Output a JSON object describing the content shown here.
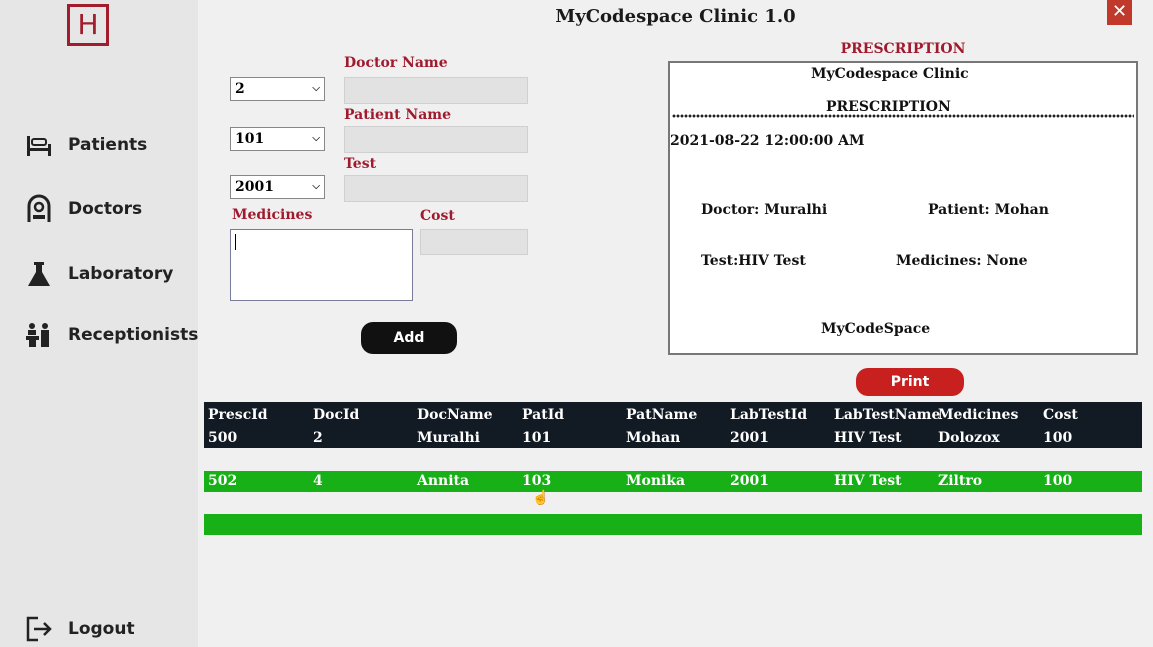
{
  "window": {
    "title": "MyCodespace Clinic 1.0",
    "close_label": "✕"
  },
  "sidebar": {
    "logo_letter": "H",
    "items": [
      {
        "label": "Patients",
        "icon": "bed-icon"
      },
      {
        "label": "Doctors",
        "icon": "doctor-icon"
      },
      {
        "label": "Laboratory",
        "icon": "flask-icon"
      },
      {
        "label": "Receptionists",
        "icon": "people-icon"
      }
    ],
    "logout": {
      "label": "Logout",
      "icon": "logout-icon"
    }
  },
  "form": {
    "doctor_id": "2",
    "patient_id": "101",
    "test_id": "2001",
    "doctor_name_label": "Doctor Name",
    "patient_name_label": "Patient Name",
    "test_label": "Test",
    "medicines_label": "Medicines",
    "cost_label": "Cost",
    "doctor_name_value": "",
    "patient_name_value": "",
    "test_value": "",
    "medicines_value": "",
    "cost_value": "",
    "add_label": "Add"
  },
  "prescription": {
    "heading": "PRESCRIPTION",
    "clinic": "MyCodespace Clinic",
    "title": "PRESCRIPTION",
    "date": "2021-08-22 12:00:00 AM",
    "doctor": "Doctor: Muralhi",
    "patient": "Patient: Mohan",
    "test": "Test:HIV Test",
    "medicines": "Medicines: None",
    "footer": "MyCodeSpace",
    "print_label": "Print"
  },
  "table": {
    "headers": [
      "PrescId",
      "DocId",
      "DocName",
      "PatId",
      "PatName",
      "LabTestId",
      "LabTestName",
      "Medicines",
      "Cost"
    ],
    "rows": [
      [
        "500",
        "2",
        "Muralhi",
        "101",
        "Mohan",
        "2001",
        "HIV Test",
        "Dolozox",
        "100"
      ],
      [
        "502",
        "4",
        "Annita",
        "103",
        "Monika",
        "2001",
        "HIV Test",
        "Ziltro",
        "100"
      ],
      [
        "",
        "",
        "",
        "",
        "",
        "",
        "",
        "",
        ""
      ]
    ],
    "colors": {
      "header": "#121a24",
      "selected": "#17b117"
    }
  },
  "colors": {
    "accent": "#a01a2e",
    "print": "#c8201e",
    "close": "#c0392b"
  }
}
